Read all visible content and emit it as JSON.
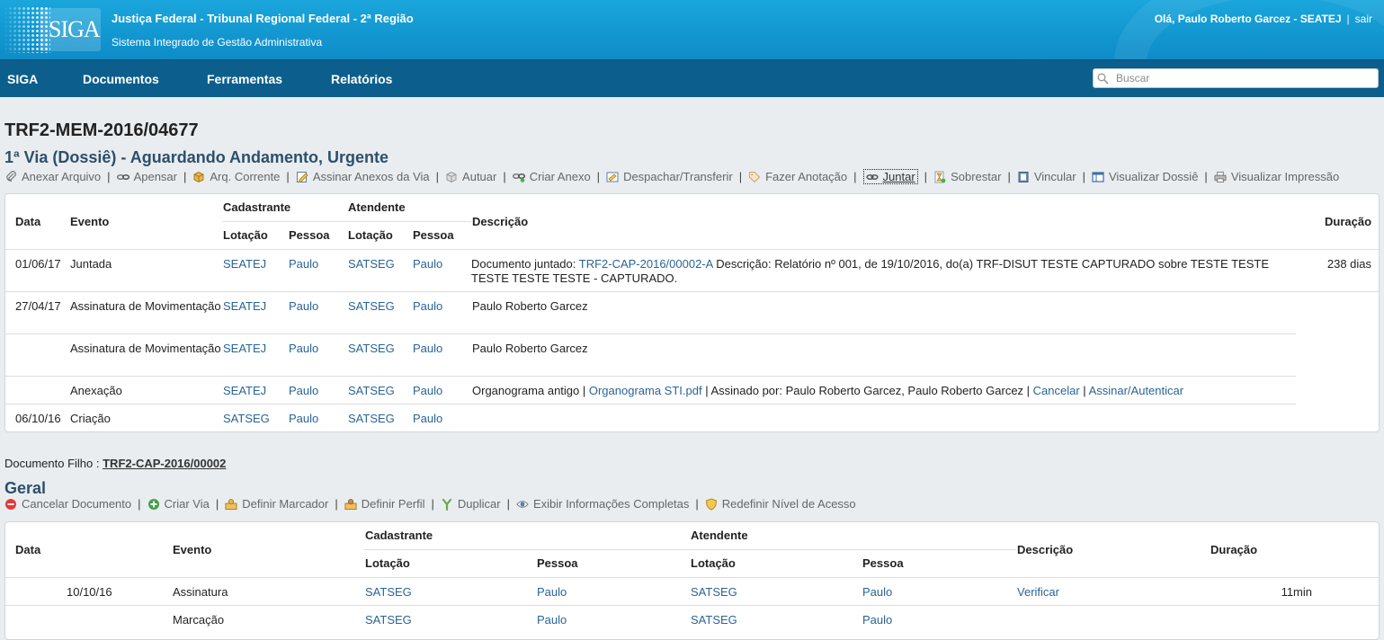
{
  "header": {
    "logo_text": "SIGA",
    "org": "Justiça Federal - Tribunal Regional Federal - 2ª Região",
    "system": "Sistema Integrado de Gestão Administrativa",
    "greeting": "Olá, Paulo Roberto Garcez - SEATEJ",
    "separator": "|",
    "logout": "sair"
  },
  "nav": {
    "items": [
      "SIGA",
      "Documentos",
      "Ferramentas",
      "Relatórios"
    ],
    "search_placeholder": "Buscar"
  },
  "doc": {
    "code": "TRF2-MEM-2016/04677",
    "via_title": "1ª Via (Dossiê) - Aguardando Andamento, Urgente",
    "via_actions": [
      {
        "label": "Anexar Arquivo",
        "icon": "paperclip-icon"
      },
      {
        "label": "Apensar",
        "icon": "link-icon"
      },
      {
        "label": "Arq. Corrente",
        "icon": "box-icon"
      },
      {
        "label": "Assinar Anexos da Via",
        "icon": "sign-icon"
      },
      {
        "label": "Autuar",
        "icon": "box-gray-icon"
      },
      {
        "label": "Criar Anexo",
        "icon": "link-add-icon"
      },
      {
        "label": "Despachar/Transferir",
        "icon": "forward-icon"
      },
      {
        "label": "Fazer Anotação",
        "icon": "tag-icon"
      },
      {
        "label": "Juntar",
        "icon": "chain-icon"
      },
      {
        "label": "Sobrestar",
        "icon": "hourglass-icon"
      },
      {
        "label": "Vincular",
        "icon": "binder-icon"
      },
      {
        "label": "Visualizar Dossiê",
        "icon": "window-icon"
      },
      {
        "label": "Visualizar Impressão",
        "icon": "printer-icon"
      }
    ],
    "via_table": {
      "headers": {
        "data": "Data",
        "evento": "Evento",
        "cadastrante": "Cadastrante",
        "atendente": "Atendente",
        "lotacao": "Lotação",
        "pessoa": "Pessoa",
        "descricao": "Descrição",
        "duracao": "Duração"
      },
      "rows": [
        {
          "data": "01/06/17",
          "evento": "Juntada",
          "cad_lot": "SEATEJ",
          "cad_pes": "Paulo",
          "ate_lot": "SATSEG",
          "ate_pes": "Paulo",
          "desc_prefix": "Documento juntado: ",
          "desc_link": "TRF2-CAP-2016/00002-A",
          "desc_suffix": " Descrição: Relatório nº 001, de 19/10/2016, do(a) TRF-DISUT TESTE CAPTURADO sobre TESTE TESTE TESTE TESTE TESTE - CAPTURADO.",
          "duracao": "238 dias"
        },
        {
          "data": "27/04/17",
          "evento": "Assinatura de Movimentação",
          "cad_lot": "SEATEJ",
          "cad_pes": "Paulo",
          "ate_lot": "SATSEG",
          "ate_pes": "Paulo",
          "descricao": "Paulo Roberto Garcez"
        },
        {
          "data": "",
          "evento": "Assinatura de Movimentação",
          "cad_lot": "SEATEJ",
          "cad_pes": "Paulo",
          "ate_lot": "SATSEG",
          "ate_pes": "Paulo",
          "descricao": "Paulo Roberto Garcez"
        },
        {
          "data": "",
          "evento": "Anexação",
          "cad_lot": "SEATEJ",
          "cad_pes": "Paulo",
          "ate_lot": "SATSEG",
          "ate_pes": "Paulo",
          "desc_prefix": "Organograma antigo | ",
          "desc_link": "Organograma STI.pdf",
          "desc_mid": " | Assinado por: Paulo Roberto Garcez, Paulo Roberto Garcez | ",
          "desc_link2": "Cancelar",
          "desc_sep": " | ",
          "desc_link3": "Assinar/Autenticar"
        },
        {
          "data": "06/10/16",
          "evento": "Criação",
          "cad_lot": "SATSEG",
          "cad_pes": "Paulo",
          "ate_lot": "SATSEG",
          "ate_pes": "Paulo",
          "descricao": ""
        }
      ]
    },
    "filho_label": "Documento Filho : ",
    "filho_link": "TRF2-CAP-2016/00002",
    "geral_title": "Geral",
    "geral_actions": [
      {
        "label": "Cancelar Documento",
        "icon": "cancel-icon"
      },
      {
        "label": "Criar Via",
        "icon": "add-icon"
      },
      {
        "label": "Definir Marcador",
        "icon": "marker-icon"
      },
      {
        "label": "Definir Perfil",
        "icon": "profile-icon"
      },
      {
        "label": "Duplicar",
        "icon": "duplicate-icon"
      },
      {
        "label": "Exibir Informações Completas",
        "icon": "eye-icon"
      },
      {
        "label": "Redefinir Nível de Acesso",
        "icon": "shield-icon"
      }
    ],
    "geral_table": {
      "rows": [
        {
          "data": "10/10/16",
          "evento": "Assinatura",
          "cad_lot": "SATSEG",
          "cad_pes": "Paulo",
          "ate_lot": "SATSEG",
          "ate_pes": "Paulo",
          "descricao": "Verificar",
          "duracao": "11min"
        },
        {
          "data": "",
          "evento": "Marcação",
          "cad_lot": "SATSEG",
          "cad_pes": "Paulo",
          "ate_lot": "SATSEG",
          "ate_pes": "Paulo",
          "descricao": "",
          "duracao": ""
        }
      ]
    }
  }
}
